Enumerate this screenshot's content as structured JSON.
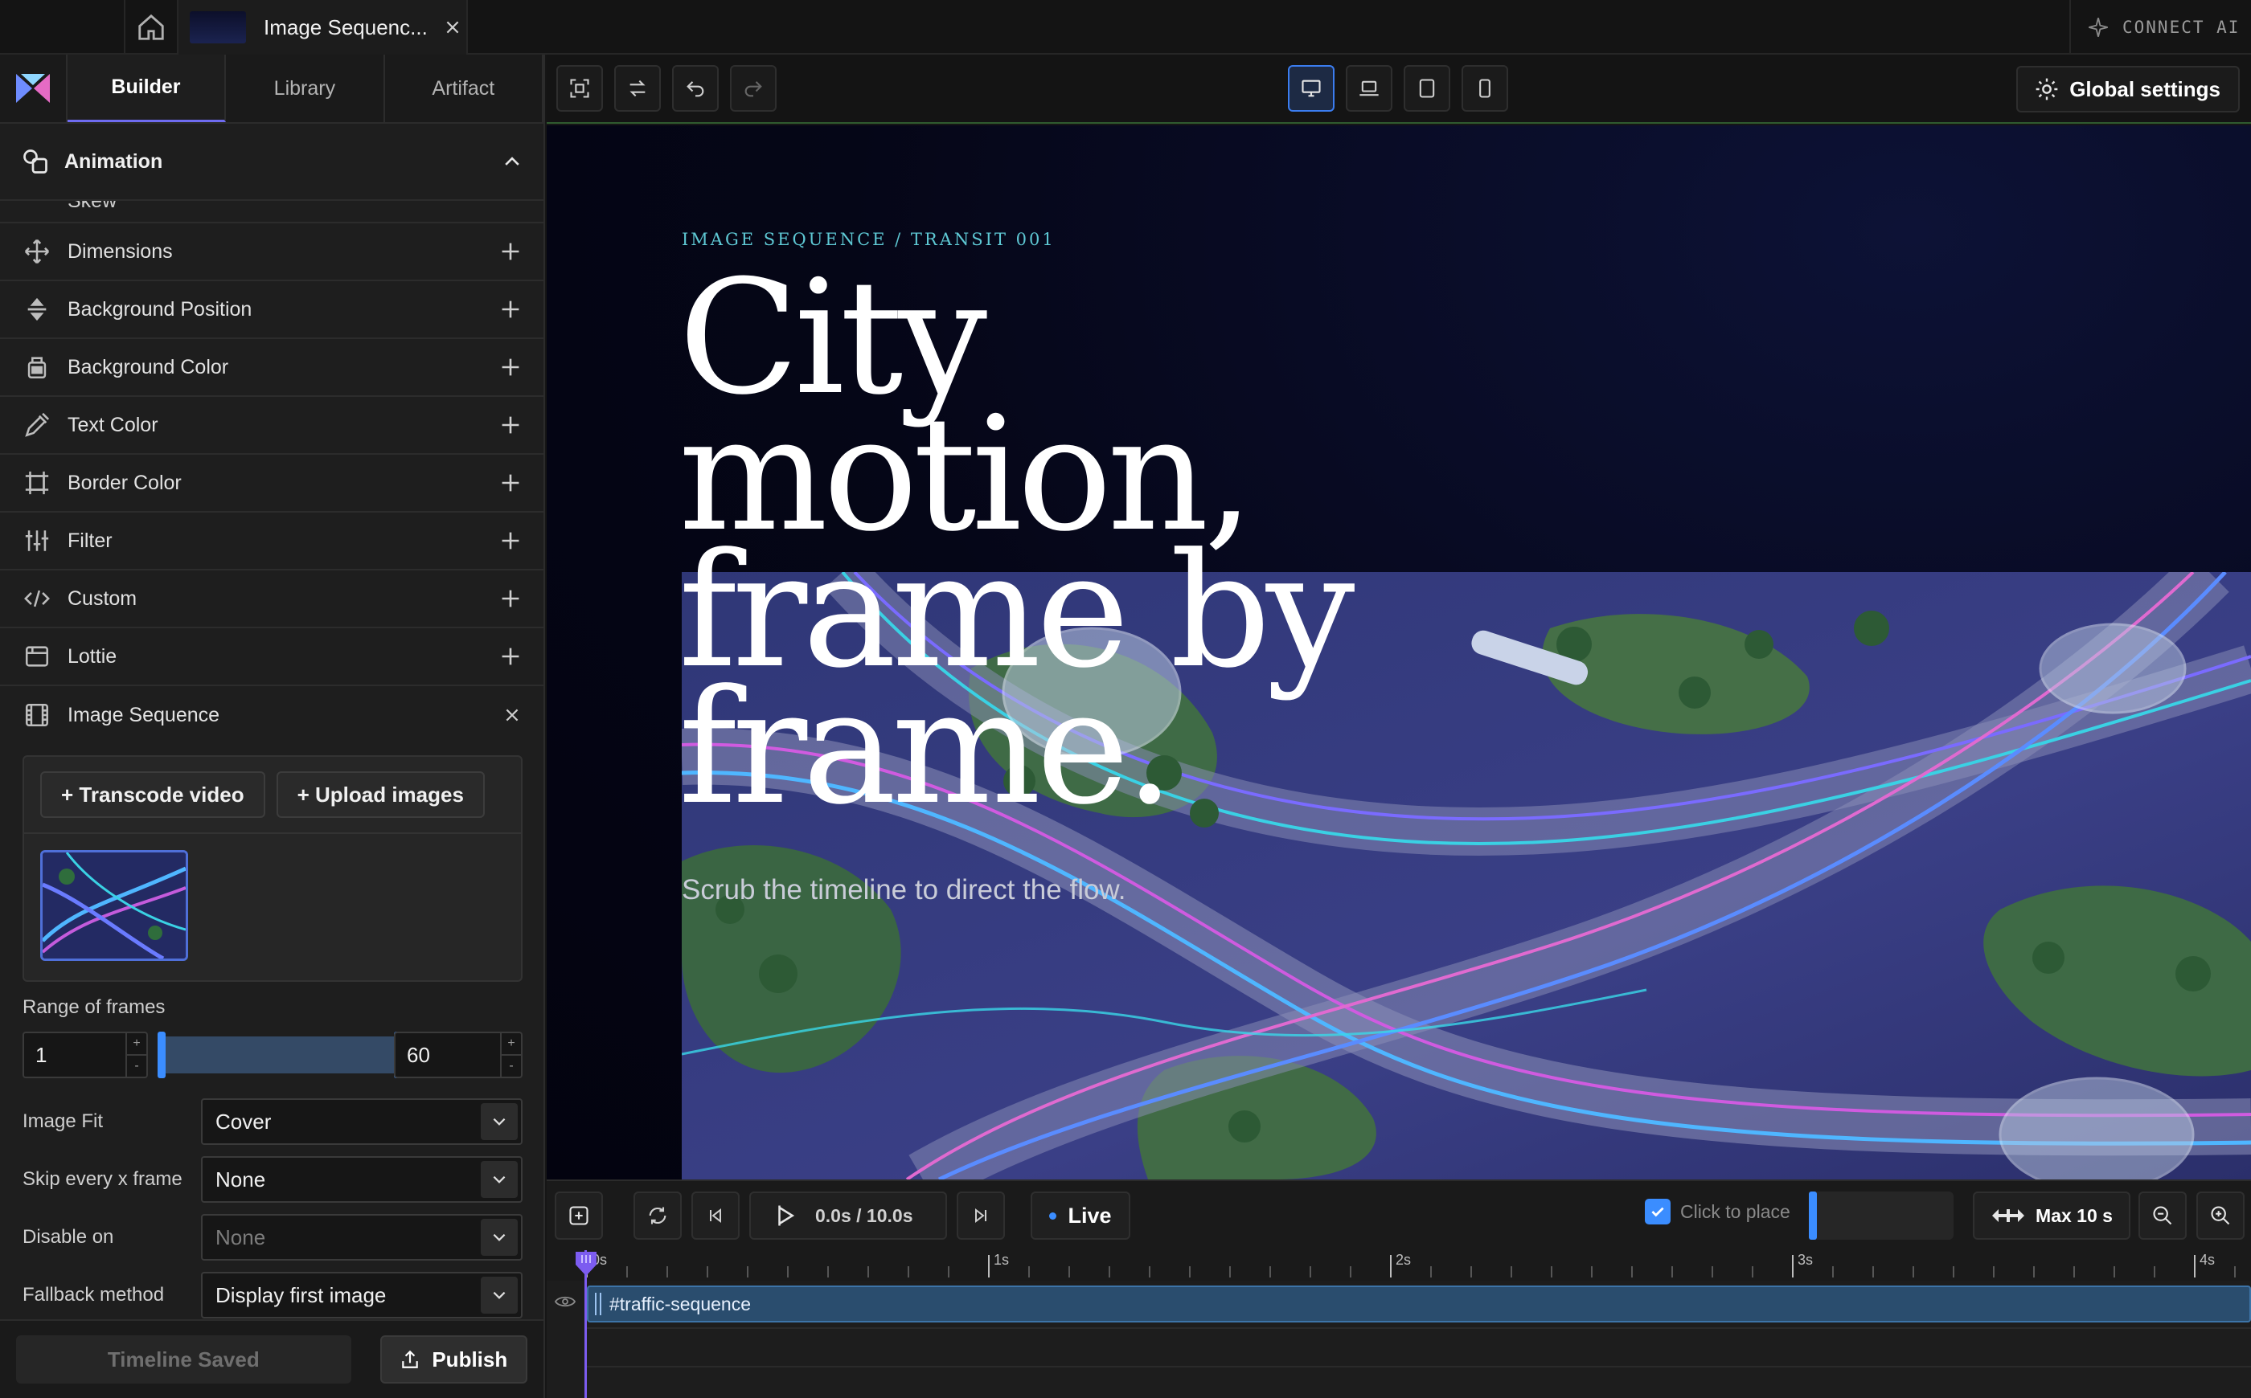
{
  "topbar": {
    "doc_tab_title": "Image Sequenc...",
    "connect_ai": "CONNECT AI"
  },
  "left_panel": {
    "tabs": [
      {
        "label": "Builder",
        "active": true
      },
      {
        "label": "Library",
        "active": false
      },
      {
        "label": "Artifact",
        "active": false
      }
    ],
    "section_title": "Animation",
    "partial_item_label": "Skew",
    "properties": [
      {
        "label": "Dimensions",
        "icon": "move-arrows-icon"
      },
      {
        "label": "Background Position",
        "icon": "vertical-arrows-icon"
      },
      {
        "label": "Background Color",
        "icon": "paint-bucket-icon"
      },
      {
        "label": "Text Color",
        "icon": "eyedropper-icon"
      },
      {
        "label": "Border Color",
        "icon": "border-frame-icon"
      },
      {
        "label": "Filter",
        "icon": "sliders-icon"
      },
      {
        "label": "Custom",
        "icon": "code-icon"
      },
      {
        "label": "Lottie",
        "icon": "lottie-box-icon"
      }
    ],
    "image_sequence": {
      "label": "Image Sequence",
      "transcode_label": "+ Transcode video",
      "upload_label": "+ Upload images",
      "range_label": "Range of frames",
      "range_start": "1",
      "range_end": "60",
      "step_up": "+",
      "step_down": "-",
      "fields": [
        {
          "label": "Image Fit",
          "value": "Cover",
          "dim": false
        },
        {
          "label": "Skip every x frame",
          "value": "None",
          "dim": false
        },
        {
          "label": "Disable on",
          "value": "None",
          "dim": true
        },
        {
          "label": "Fallback method",
          "value": "Display first image",
          "dim": false
        }
      ]
    },
    "footer": {
      "saved_label": "Timeline Saved",
      "publish_label": "Publish"
    }
  },
  "toolbar": {
    "global_settings_label": "Global settings",
    "active_device": "desktop"
  },
  "canvas": {
    "eyebrow": "IMAGE SEQUENCE / TRANSIT 001",
    "headline_lines": [
      "City",
      "motion,",
      "frame by",
      "frame."
    ],
    "subline": "Scrub the timeline to direct the flow."
  },
  "timeline": {
    "time_display": "0.0s / 10.0s",
    "live_label": "Live",
    "click_to_place_label": "Click to place",
    "click_to_place_checked": true,
    "max_label": "Max 10 s",
    "ruler_labels": [
      "0s",
      "1s",
      "2s",
      "3s",
      "4s"
    ],
    "track_name": "#traffic-sequence"
  },
  "colors": {
    "accent_blue": "#3b8dff",
    "playhead_purple": "#7c5cf0",
    "eyebrow_teal": "#5ec8d4",
    "track_blue": "#2a4d6e"
  }
}
